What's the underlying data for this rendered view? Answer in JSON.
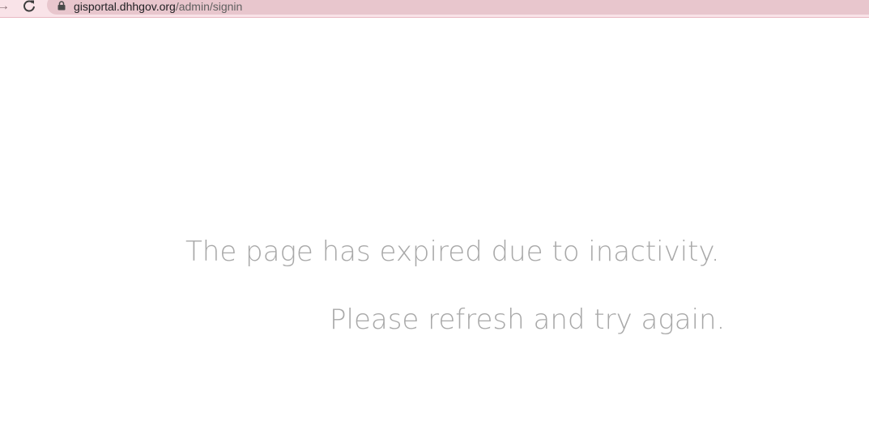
{
  "browser": {
    "url_host": "gisportal.dhhgov.org",
    "url_path": "/admin/signin",
    "icons": {
      "forward": "forward-arrow-icon",
      "reload": "reload-icon",
      "lock": "lock-icon"
    },
    "colors": {
      "toolbar": "#f9e3e8",
      "omnibox": "#e8c6cd"
    }
  },
  "page": {
    "message_line1": "The page has expired due to inactivity.",
    "message_line2": "Please refresh and try again.",
    "text_color": "#a8a8a8"
  }
}
